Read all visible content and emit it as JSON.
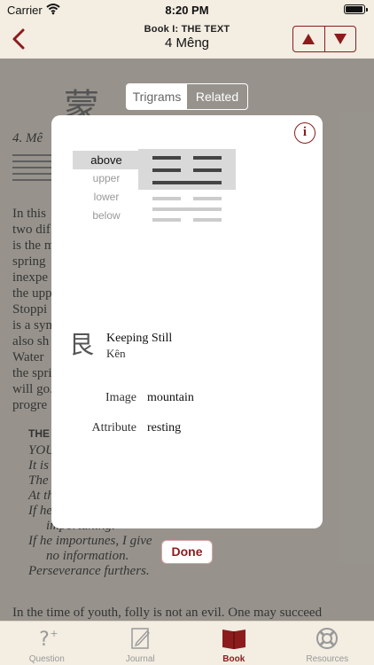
{
  "status": {
    "carrier": "Carrier",
    "time": "8:20 PM"
  },
  "nav": {
    "subtitle": "Book I: THE TEXT",
    "title": "4 Mêng"
  },
  "background": {
    "glyph": "蒙",
    "heading_num": "4.",
    "heading_name": "Mê",
    "paragraph1": [
      "In this",
      "two dif",
      "is the m",
      "spring",
      "inexpe",
      "the upper",
      "Stoppi",
      "is a syml",
      "also sh",
      "Water",
      "the spring",
      "will go. But",
      "progre"
    ],
    "judgment_heading": "THE",
    "judgment_lines": [
      "YOU",
      "It is",
      "The",
      "At th",
      "If he",
      "importuning.",
      "If he importunes, I give",
      "no information.",
      "Perseverance furthers."
    ],
    "footer_para": "In the time of youth, folly is not an evil. One may succeed"
  },
  "segmented": {
    "items": [
      "Trigrams",
      "Related"
    ],
    "selected": "Related"
  },
  "modal": {
    "info_label": "i",
    "positions": [
      "above",
      "upper",
      "lower",
      "below"
    ],
    "selected_position": "above",
    "hexagram_lines": [
      {
        "type": "broken",
        "group": "upper"
      },
      {
        "type": "broken",
        "group": "upper"
      },
      {
        "type": "solid",
        "group": "upper"
      },
      {
        "type": "broken",
        "group": "lower"
      },
      {
        "type": "solid",
        "group": "lower"
      },
      {
        "type": "broken",
        "group": "lower"
      }
    ],
    "trigram": {
      "glyph": "艮",
      "name": "Keeping Still",
      "pinyin": "Kên"
    },
    "attributes": [
      {
        "label": "Image",
        "value": "mountain"
      },
      {
        "label": "Attribute",
        "value": "resting"
      }
    ]
  },
  "done_label": "Done",
  "tabs": [
    {
      "label": "Question",
      "icon": "question-icon"
    },
    {
      "label": "Journal",
      "icon": "journal-icon"
    },
    {
      "label": "Book",
      "icon": "book-icon",
      "active": true
    },
    {
      "label": "Resources",
      "icon": "lifebuoy-icon"
    }
  ],
  "colors": {
    "accent": "#8c1c1c",
    "line_dark": "#444444",
    "line_light": "#cccccc",
    "selection_bg": "#d9d9d9"
  }
}
